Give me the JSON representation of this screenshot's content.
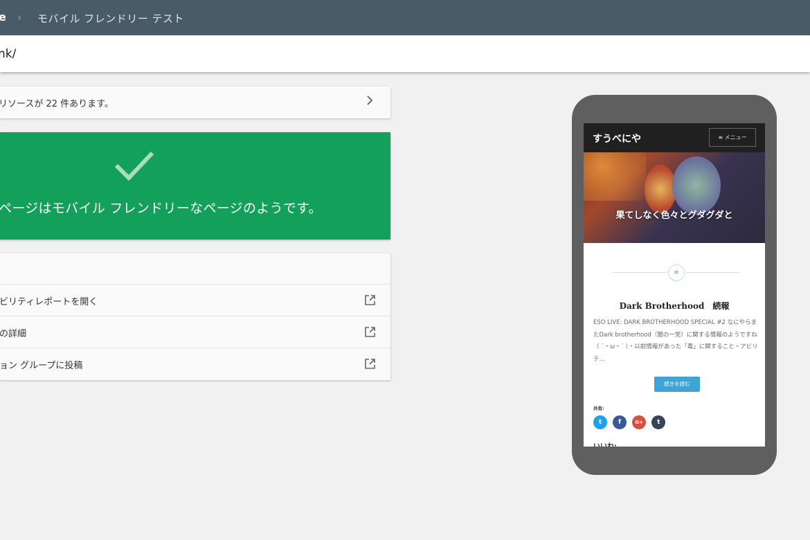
{
  "header": {
    "breadcrumb_root": "e",
    "breadcrumb_separator": "›",
    "title": "モバイル フレンドリー テスト",
    "background": "#4a5b68"
  },
  "url_bar": {
    "value": "nk/"
  },
  "resources_card": {
    "text": "リソースが 22 件あります。",
    "chevron_icon": "chevron-right-icon"
  },
  "result": {
    "status": "pass",
    "icon": "checkmark-icon",
    "message": "ページはモバイル フレンドリーなページのようです。",
    "background": "#13a05a"
  },
  "links": [
    {
      "label": "ビリティレポートを開く",
      "icon": "open-in-new-icon"
    },
    {
      "label": "の詳細",
      "icon": "open-in-new-icon"
    },
    {
      "label": "ョン グループに投稿",
      "icon": "open-in-new-icon"
    }
  ],
  "phone_preview": {
    "site_title": "すうべにや",
    "menu_label": "≡ メニュー",
    "hero_tagline": "果てしなく色々とグダグダと",
    "post_title": "Dark Brotherhood　続報",
    "post_excerpt": "ESO LIVE: DARK BROTHERHOOD SPECIAL #2 なにやらまたDark brotherhood（闇の一党）に関する情報のようですね（ ˙・ω・˙ ）・以前情報があった「毒」に関すること・アビリテ…",
    "read_more": "続きを読む",
    "share_label": "共有:",
    "share_buttons": [
      {
        "icon": "twitter-icon",
        "glyph": "t",
        "color": "#1da1f2"
      },
      {
        "icon": "facebook-icon",
        "glyph": "f",
        "color": "#3b5998"
      },
      {
        "icon": "google-plus-icon",
        "glyph": "G+",
        "color": "#dc4e41"
      },
      {
        "icon": "tumblr-icon",
        "glyph": "t",
        "color": "#35465c"
      }
    ],
    "next_section_label": "いいね:"
  }
}
